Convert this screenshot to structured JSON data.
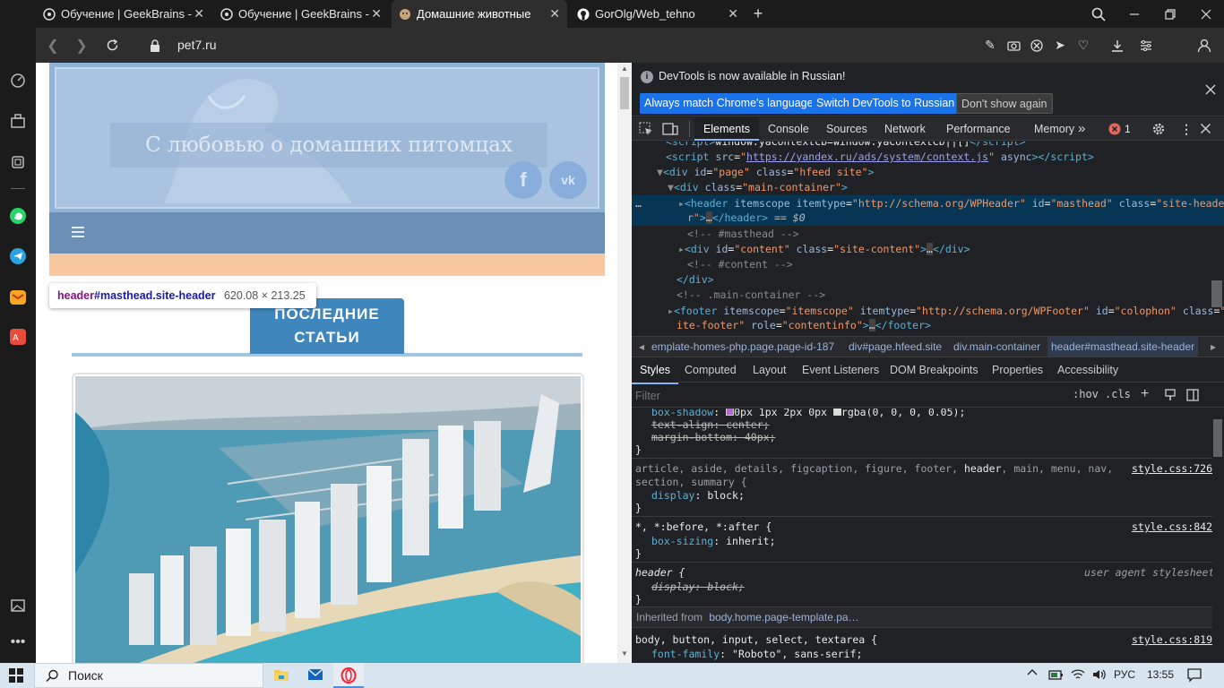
{
  "browser": {
    "tabs": [
      {
        "title": "Обучение | GeekBrains - о"
      },
      {
        "title": "Обучение | GeekBrains - о"
      },
      {
        "title": "Домашние животные"
      },
      {
        "title": "GorOlg/Web_tehno"
      }
    ],
    "url": "pet7.ru"
  },
  "site": {
    "header_title": "С любовью о домашних питомцах",
    "section_heading_line1": "ПОСЛЕДНИЕ",
    "section_heading_line2": "СТАТЬИ",
    "inspect_tooltip": {
      "tag": "header",
      "selector": "#masthead.site-header",
      "size": "620.08 × 213.25"
    }
  },
  "devtools": {
    "banner_text": "DevTools is now available in Russian!",
    "btn_match": "Always match Chrome's language",
    "btn_switch": "Switch DevTools to Russian",
    "btn_dont_show": "Don't show again",
    "tabs": [
      "Elements",
      "Console",
      "Sources",
      "Network",
      "Performance",
      "Memory"
    ],
    "error_count": "1",
    "breadcrumbs": [
      "emplate-homes-php.page.page-id-187",
      "div#page.hfeed.site",
      "div.main-container",
      "header#masthead.site-header"
    ],
    "style_tabs": [
      "Styles",
      "Computed",
      "Layout",
      "Event Listeners",
      "DOM Breakpoints",
      "Properties",
      "Accessibility"
    ],
    "filter_placeholder": "Filter",
    "hov": ":hov",
    "cls": ".cls",
    "rules": {
      "r1_prop1": "box-shadow",
      "r1_val1": "0px 1px 2px 0px",
      "r1_val1b": "rgba(0, 0, 0, 0.05);",
      "r1_prop2": "text-align: center;",
      "r1_prop3": "margin-bottom: 40px;",
      "r2_sel_a": "article, aside, details, figcaption, figure, footer, ",
      "r2_sel_b": "header",
      "r2_sel_c": ", main, menu, nav,",
      "r2_sel_d": "section, summary {",
      "r2_src": "style.css:726",
      "r2_prop": "display",
      "r2_val": "block;",
      "r3_sel": "*, *:before, *:after {",
      "r3_src": "style.css:842",
      "r3_prop": "box-sizing",
      "r3_val": "inherit;",
      "r4_sel": "header {",
      "r4_src": "user agent stylesheet",
      "r4_prop": "display: block;",
      "inherited_label": "Inherited from",
      "inherited_src": "body.home.page-template.pa…",
      "r5_sel": "body, button, input, select, textarea {",
      "r5_src": "style.css:819",
      "r5_prop": "font-family",
      "r5_val": "\"Roboto\", sans-serif;"
    }
  },
  "taskbar": {
    "search_label": "Поиск",
    "lang": "РУС",
    "time": "13:55"
  }
}
